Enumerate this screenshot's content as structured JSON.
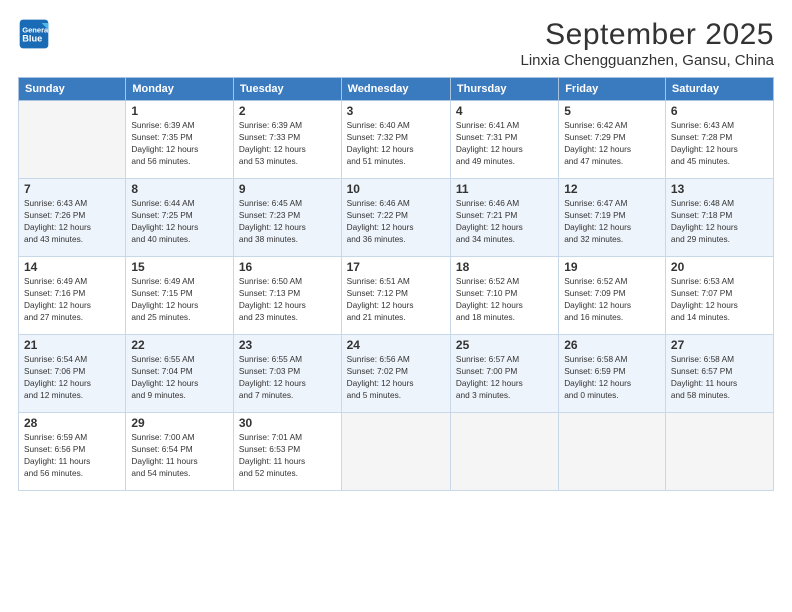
{
  "logo": {
    "line1": "General",
    "line2": "Blue"
  },
  "header": {
    "month": "September 2025",
    "location": "Linxia Chengguanzhen, Gansu, China"
  },
  "weekdays": [
    "Sunday",
    "Monday",
    "Tuesday",
    "Wednesday",
    "Thursday",
    "Friday",
    "Saturday"
  ],
  "weeks": [
    [
      {
        "day": "",
        "info": ""
      },
      {
        "day": "1",
        "info": "Sunrise: 6:39 AM\nSunset: 7:35 PM\nDaylight: 12 hours\nand 56 minutes."
      },
      {
        "day": "2",
        "info": "Sunrise: 6:39 AM\nSunset: 7:33 PM\nDaylight: 12 hours\nand 53 minutes."
      },
      {
        "day": "3",
        "info": "Sunrise: 6:40 AM\nSunset: 7:32 PM\nDaylight: 12 hours\nand 51 minutes."
      },
      {
        "day": "4",
        "info": "Sunrise: 6:41 AM\nSunset: 7:31 PM\nDaylight: 12 hours\nand 49 minutes."
      },
      {
        "day": "5",
        "info": "Sunrise: 6:42 AM\nSunset: 7:29 PM\nDaylight: 12 hours\nand 47 minutes."
      },
      {
        "day": "6",
        "info": "Sunrise: 6:43 AM\nSunset: 7:28 PM\nDaylight: 12 hours\nand 45 minutes."
      }
    ],
    [
      {
        "day": "7",
        "info": "Sunrise: 6:43 AM\nSunset: 7:26 PM\nDaylight: 12 hours\nand 43 minutes."
      },
      {
        "day": "8",
        "info": "Sunrise: 6:44 AM\nSunset: 7:25 PM\nDaylight: 12 hours\nand 40 minutes."
      },
      {
        "day": "9",
        "info": "Sunrise: 6:45 AM\nSunset: 7:23 PM\nDaylight: 12 hours\nand 38 minutes."
      },
      {
        "day": "10",
        "info": "Sunrise: 6:46 AM\nSunset: 7:22 PM\nDaylight: 12 hours\nand 36 minutes."
      },
      {
        "day": "11",
        "info": "Sunrise: 6:46 AM\nSunset: 7:21 PM\nDaylight: 12 hours\nand 34 minutes."
      },
      {
        "day": "12",
        "info": "Sunrise: 6:47 AM\nSunset: 7:19 PM\nDaylight: 12 hours\nand 32 minutes."
      },
      {
        "day": "13",
        "info": "Sunrise: 6:48 AM\nSunset: 7:18 PM\nDaylight: 12 hours\nand 29 minutes."
      }
    ],
    [
      {
        "day": "14",
        "info": "Sunrise: 6:49 AM\nSunset: 7:16 PM\nDaylight: 12 hours\nand 27 minutes."
      },
      {
        "day": "15",
        "info": "Sunrise: 6:49 AM\nSunset: 7:15 PM\nDaylight: 12 hours\nand 25 minutes."
      },
      {
        "day": "16",
        "info": "Sunrise: 6:50 AM\nSunset: 7:13 PM\nDaylight: 12 hours\nand 23 minutes."
      },
      {
        "day": "17",
        "info": "Sunrise: 6:51 AM\nSunset: 7:12 PM\nDaylight: 12 hours\nand 21 minutes."
      },
      {
        "day": "18",
        "info": "Sunrise: 6:52 AM\nSunset: 7:10 PM\nDaylight: 12 hours\nand 18 minutes."
      },
      {
        "day": "19",
        "info": "Sunrise: 6:52 AM\nSunset: 7:09 PM\nDaylight: 12 hours\nand 16 minutes."
      },
      {
        "day": "20",
        "info": "Sunrise: 6:53 AM\nSunset: 7:07 PM\nDaylight: 12 hours\nand 14 minutes."
      }
    ],
    [
      {
        "day": "21",
        "info": "Sunrise: 6:54 AM\nSunset: 7:06 PM\nDaylight: 12 hours\nand 12 minutes."
      },
      {
        "day": "22",
        "info": "Sunrise: 6:55 AM\nSunset: 7:04 PM\nDaylight: 12 hours\nand 9 minutes."
      },
      {
        "day": "23",
        "info": "Sunrise: 6:55 AM\nSunset: 7:03 PM\nDaylight: 12 hours\nand 7 minutes."
      },
      {
        "day": "24",
        "info": "Sunrise: 6:56 AM\nSunset: 7:02 PM\nDaylight: 12 hours\nand 5 minutes."
      },
      {
        "day": "25",
        "info": "Sunrise: 6:57 AM\nSunset: 7:00 PM\nDaylight: 12 hours\nand 3 minutes."
      },
      {
        "day": "26",
        "info": "Sunrise: 6:58 AM\nSunset: 6:59 PM\nDaylight: 12 hours\nand 0 minutes."
      },
      {
        "day": "27",
        "info": "Sunrise: 6:58 AM\nSunset: 6:57 PM\nDaylight: 11 hours\nand 58 minutes."
      }
    ],
    [
      {
        "day": "28",
        "info": "Sunrise: 6:59 AM\nSunset: 6:56 PM\nDaylight: 11 hours\nand 56 minutes."
      },
      {
        "day": "29",
        "info": "Sunrise: 7:00 AM\nSunset: 6:54 PM\nDaylight: 11 hours\nand 54 minutes."
      },
      {
        "day": "30",
        "info": "Sunrise: 7:01 AM\nSunset: 6:53 PM\nDaylight: 11 hours\nand 52 minutes."
      },
      {
        "day": "",
        "info": ""
      },
      {
        "day": "",
        "info": ""
      },
      {
        "day": "",
        "info": ""
      },
      {
        "day": "",
        "info": ""
      }
    ]
  ]
}
